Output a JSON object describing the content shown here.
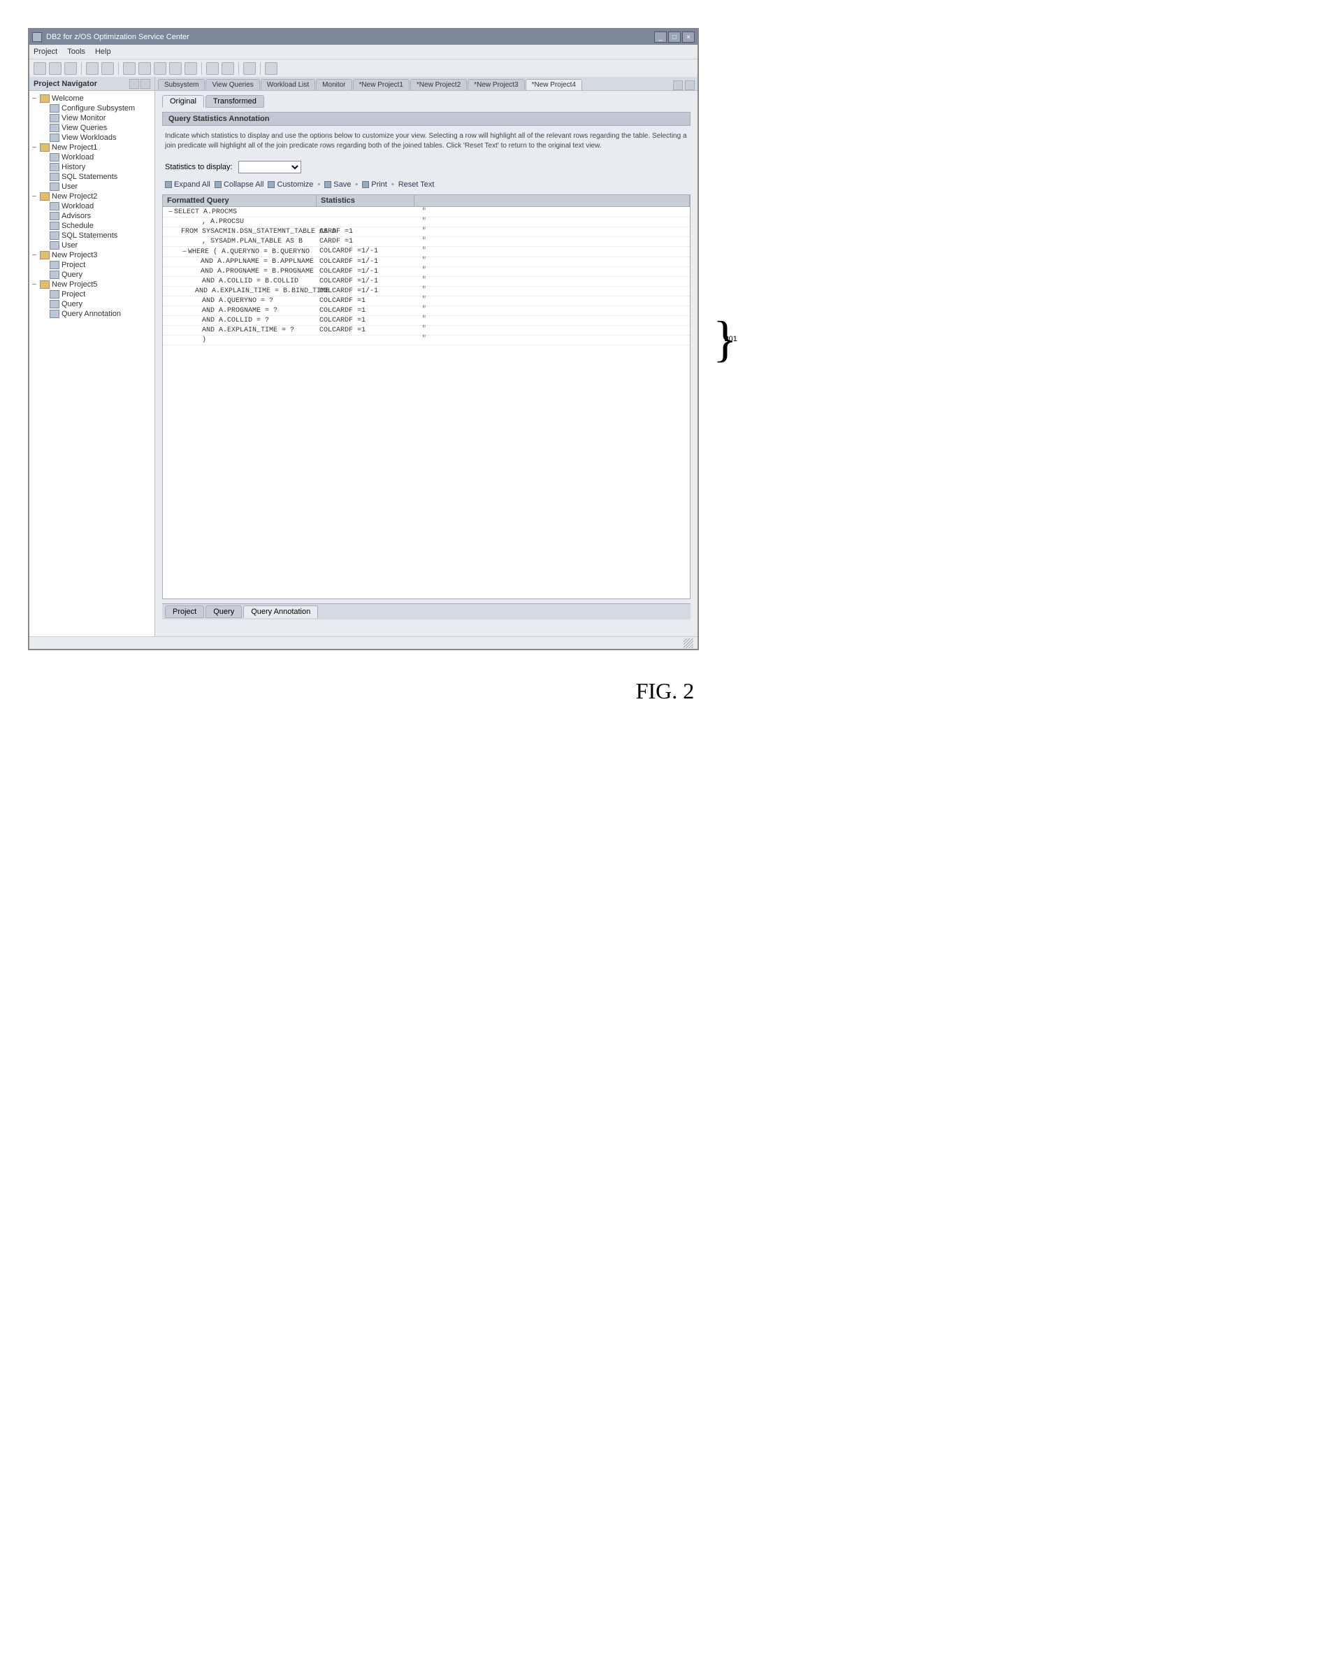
{
  "window": {
    "title": "DB2 for z/OS Optimization Service Center"
  },
  "menu": {
    "items": [
      "Project",
      "Tools",
      "Help"
    ]
  },
  "navigator": {
    "title": "Project Navigator",
    "nodes": [
      {
        "tgl": "−",
        "label": "Welcome",
        "icon": "folder",
        "indent": 0
      },
      {
        "tgl": "",
        "label": "Configure Subsystem",
        "icon": "leaf",
        "indent": 1
      },
      {
        "tgl": "",
        "label": "View Monitor",
        "icon": "leaf",
        "indent": 1
      },
      {
        "tgl": "",
        "label": "View Queries",
        "icon": "leaf",
        "indent": 1
      },
      {
        "tgl": "",
        "label": "View Workloads",
        "icon": "leaf",
        "indent": 1
      },
      {
        "tgl": "−",
        "label": "New Project1",
        "icon": "folder",
        "indent": 0
      },
      {
        "tgl": "",
        "label": "Workload",
        "icon": "leaf",
        "indent": 1
      },
      {
        "tgl": "",
        "label": "History",
        "icon": "leaf",
        "indent": 1
      },
      {
        "tgl": "",
        "label": "SQL Statements",
        "icon": "leaf",
        "indent": 1
      },
      {
        "tgl": "",
        "label": "User",
        "icon": "leaf",
        "indent": 1
      },
      {
        "tgl": "−",
        "label": "New Project2",
        "icon": "folder",
        "indent": 0
      },
      {
        "tgl": "",
        "label": "Workload",
        "icon": "leaf",
        "indent": 1
      },
      {
        "tgl": "",
        "label": "Advisors",
        "icon": "leaf",
        "indent": 1
      },
      {
        "tgl": "",
        "label": "Schedule",
        "icon": "leaf",
        "indent": 1
      },
      {
        "tgl": "",
        "label": "SQL Statements",
        "icon": "leaf",
        "indent": 1
      },
      {
        "tgl": "",
        "label": "User",
        "icon": "leaf",
        "indent": 1
      },
      {
        "tgl": "−",
        "label": "New Project3",
        "icon": "folder",
        "indent": 0
      },
      {
        "tgl": "",
        "label": "Project",
        "icon": "leaf",
        "indent": 1
      },
      {
        "tgl": "",
        "label": "Query",
        "icon": "leaf",
        "indent": 1
      },
      {
        "tgl": "−",
        "label": "New Project5",
        "icon": "folder",
        "indent": 0
      },
      {
        "tgl": "",
        "label": "Project",
        "icon": "leaf",
        "indent": 1
      },
      {
        "tgl": "",
        "label": "Query",
        "icon": "leaf",
        "indent": 1
      },
      {
        "tgl": "",
        "label": "Query Annotation",
        "icon": "leaf",
        "indent": 1
      }
    ]
  },
  "topTabs": {
    "items": [
      "Subsystem",
      "View Queries",
      "Workload List",
      "Monitor",
      "*New Project1",
      "*New Project2",
      "*New Project3",
      "*New Project4"
    ],
    "activeIndex": 7
  },
  "subTabs": {
    "items": [
      "Original",
      "Transformed"
    ],
    "activeIndex": 0
  },
  "section": {
    "title": "Query Statistics Annotation"
  },
  "hint": "Indicate which statistics to display and use the options below to customize your view. Selecting a row will highlight all of the relevant rows regarding the table. Selecting a join predicate will highlight all of the join predicate rows regarding both of the joined tables. Click 'Reset Text' to return to the original text view.",
  "statLabel": "Statistics to display:",
  "actions": {
    "expand": "Expand All",
    "collapse": "Collapse All",
    "customize": "Customize",
    "save": "Save",
    "print": "Print",
    "reset": "Reset Text"
  },
  "grid": {
    "headers": [
      "Formatted Query",
      "Statistics",
      ""
    ],
    "rows": [
      {
        "tgl": "−",
        "q": "SELECT A.PROCMS",
        "s": "",
        "indent": 0
      },
      {
        "tgl": "",
        "q": ", A.PROCSU",
        "s": "",
        "indent": 2
      },
      {
        "tgl": "",
        "q": "FROM SYSACMIN.DSN_STATEMNT_TABLE AS A",
        "s": "CARDF =1",
        "indent": 1
      },
      {
        "tgl": "",
        "q": ", SYSADM.PLAN_TABLE AS B",
        "s": "CARDF =1",
        "indent": 2
      },
      {
        "tgl": "−",
        "q": "WHERE ( A.QUERYNO = B.QUERYNO",
        "s": "COLCARDF =1/-1",
        "indent": 1
      },
      {
        "tgl": "",
        "q": "AND A.APPLNAME = B.APPLNAME",
        "s": "COLCARDF =1/-1",
        "indent": 2
      },
      {
        "tgl": "",
        "q": "AND A.PROGNAME = B.PROGNAME",
        "s": "COLCARDF =1/-1",
        "indent": 2
      },
      {
        "tgl": "",
        "q": "AND A.COLLID = B.COLLID",
        "s": "COLCARDF =1/-1",
        "indent": 2
      },
      {
        "tgl": "",
        "q": "AND A.EXPLAIN_TIME = B.BIND_TIME",
        "s": "COLCARDF =1/-1",
        "indent": 2
      },
      {
        "tgl": "",
        "q": "AND A.QUERYNO = ?",
        "s": "COLCARDF =1",
        "indent": 2
      },
      {
        "tgl": "",
        "q": "AND A.PROGNAME = ?",
        "s": "COLCARDF =1",
        "indent": 2
      },
      {
        "tgl": "",
        "q": "AND A.COLLID = ?",
        "s": "COLCARDF =1",
        "indent": 2
      },
      {
        "tgl": "",
        "q": "AND A.EXPLAIN_TIME = ?",
        "s": "COLCARDF =1",
        "indent": 2
      },
      {
        "tgl": "",
        "q": ")",
        "s": "",
        "indent": 2
      }
    ]
  },
  "bottomTabs": {
    "items": [
      "Project",
      "Query",
      "Query Annotation"
    ],
    "activeIndex": 2
  },
  "callout": "201",
  "figure": "FIG. 2"
}
